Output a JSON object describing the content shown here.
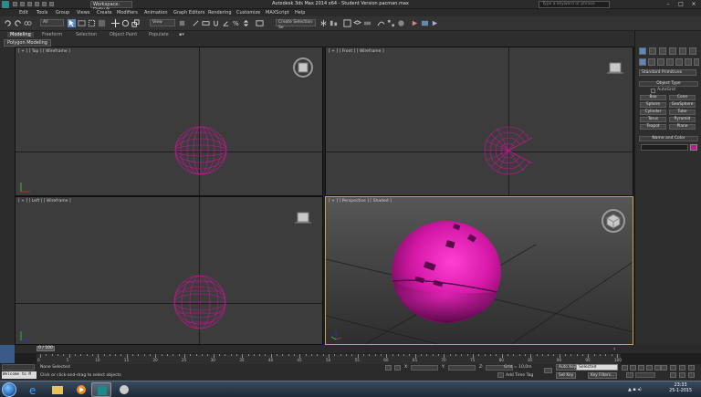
{
  "titlebar": {
    "workspace": "Workspace: Default",
    "window_title": "Autodesk 3ds Max 2014 x64  -  Student Version   pacman.max",
    "search_placeholder": "Type a keyword or phrase"
  },
  "menu": [
    "Edit",
    "Tools",
    "Group",
    "Views",
    "Create",
    "Modifiers",
    "Animation",
    "Graph Editors",
    "Rendering",
    "Customize",
    "MAXScript",
    "Help"
  ],
  "toolbar": {
    "selection_filter": "All",
    "ref_coord": "View",
    "named_selection": "Create Selection Se"
  },
  "ribbon": {
    "tabs": [
      "Modeling",
      "Freeform",
      "Selection",
      "Object Paint",
      "Populate"
    ],
    "active_panel": "Polygon Modeling"
  },
  "viewports": {
    "top": "[ + ] [ Top ] [ Wireframe ]",
    "front": "[ + ] [ Front ] [ Wireframe ]",
    "left": "[ + ] [ Left ] [ Wireframe ]",
    "perspective": "[ + ] [ Perspective ] [ Shaded ]"
  },
  "command_panel": {
    "dropdown": "Standard Primitives",
    "object_type_title": "Object Type",
    "autogrid": "AutoGrid",
    "buttons": [
      "Box",
      "Cone",
      "Sphere",
      "GeoSphere",
      "Cylinder",
      "Tube",
      "Torus",
      "Pyramid",
      "Teapot",
      "Plane"
    ],
    "name_color_title": "Name and Color"
  },
  "timeline": {
    "frame_counter": "0 / 100",
    "ticks": [
      "0",
      "5",
      "10",
      "15",
      "20",
      "25",
      "30",
      "35",
      "40",
      "45",
      "50",
      "55",
      "60",
      "65",
      "70",
      "75",
      "80",
      "85",
      "90",
      "95",
      "100"
    ]
  },
  "status": {
    "maxscript": "Welcome to M",
    "selection": "None Selected",
    "prompt": "Click or click-and-drag to select objects",
    "grid": "Grid = 10,0m",
    "add_time_tag": "Add Time Tag",
    "auto_key": "Auto Key",
    "set_key": "Set Key",
    "selected": "Selected",
    "key_filters": "Key Filters..."
  },
  "clock": {
    "time": "23:33",
    "date": "25-1-2015"
  },
  "colors": {
    "object": "#c2168f",
    "active_viewport": "#c9a24a"
  }
}
